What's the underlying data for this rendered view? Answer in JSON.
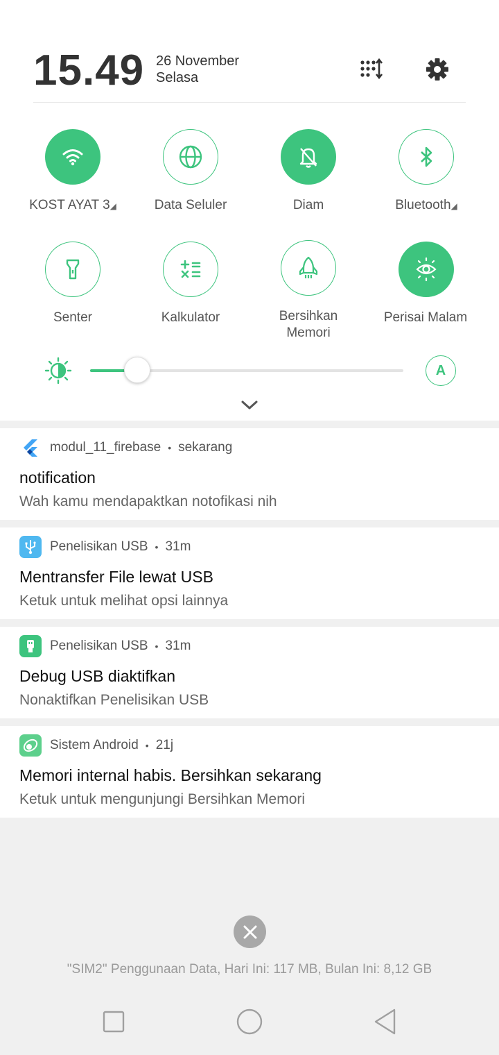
{
  "header": {
    "time": "15.49",
    "date": "26 November",
    "day": "Selasa",
    "icons": [
      "edit-tiles-icon",
      "gear-icon"
    ]
  },
  "quick_tiles": [
    {
      "label": "KOST AYAT 3",
      "icon": "wifi-icon",
      "active": true,
      "has_arrow": true
    },
    {
      "label": "Data Seluler",
      "icon": "globe-icon",
      "active": false
    },
    {
      "label": "Diam",
      "icon": "bell-off-icon",
      "active": true
    },
    {
      "label": "Bluetooth",
      "icon": "bluetooth-icon",
      "active": false,
      "has_arrow": true
    },
    {
      "label": "Senter",
      "icon": "flashlight-icon",
      "active": false
    },
    {
      "label": "Kalkulator",
      "icon": "calculator-icon",
      "active": false
    },
    {
      "label": "Bersihkan\nMemori",
      "line1": "Bersihkan",
      "line2": "Memori",
      "icon": "rocket-icon",
      "active": false
    },
    {
      "label": "Perisai Malam",
      "icon": "eye-shield-icon",
      "active": true
    }
  ],
  "arrow_glyph": "◢",
  "brightness": {
    "level": 0.15,
    "auto_label": "A"
  },
  "notifications": [
    {
      "app": "modul_11_firebase",
      "time": "sekarang",
      "title": "notification",
      "body": "Wah kamu mendapaktkan notofikasi nih",
      "icon": "flutter-icon"
    },
    {
      "app": "Penelisikan USB",
      "time": "31m",
      "title": "Mentransfer File lewat USB",
      "body": "Ketuk untuk melihat opsi lainnya",
      "icon": "usb-icon"
    },
    {
      "app": "Penelisikan USB",
      "time": "31m",
      "title": "Debug USB diaktifkan",
      "body": "Nonaktifkan Penelisikan USB",
      "icon": "android-debug-icon"
    },
    {
      "app": "Sistem Android",
      "time": "21j",
      "title": "Memori internal habis. Bersihkan sekarang",
      "body": "Ketuk untuk mengunjungi Bersihkan Memori",
      "icon": "clean-memory-icon"
    }
  ],
  "separator": "•",
  "data_usage": "\"SIM2\" Penggunaan Data, Hari Ini: 117 MB, Bulan Ini: 8,12 GB",
  "colors": {
    "accent": "#3dc47e",
    "usb_blue": "#4fb8f0"
  }
}
